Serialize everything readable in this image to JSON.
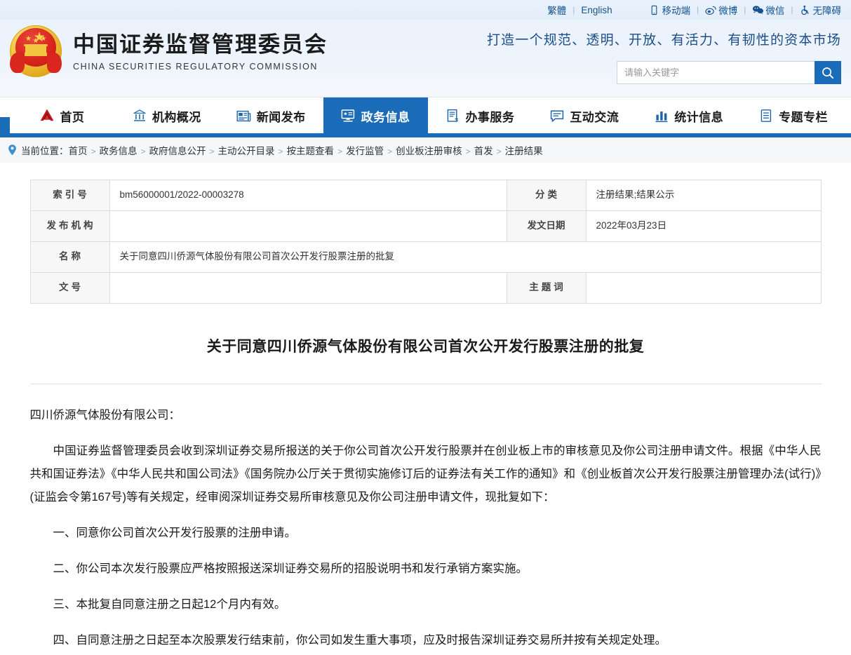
{
  "topbar": {
    "lang_traditional": "繁體",
    "lang_english": "English",
    "mobile": "移动端",
    "weibo": "微博",
    "wechat": "微信",
    "accessibility": "无障碍",
    "separator": "|",
    "accent": "#14538f"
  },
  "masthead": {
    "brand_cn": "中国证券监督管理委员会",
    "brand_en": "CHINA SECURITIES REGULATORY COMMISSION",
    "slogan": "打造一个规范、透明、开放、有活力、有韧性的资本市场",
    "search_placeholder": "请输入关键字",
    "search_value": "",
    "accent": "#1a6cb8"
  },
  "nav": {
    "active_index": 3,
    "items": [
      {
        "label": "首页",
        "icon": "csrc-home-logo-icon"
      },
      {
        "label": "机构概况",
        "icon": "bank-building-icon"
      },
      {
        "label": "新闻发布",
        "icon": "newspaper-icon"
      },
      {
        "label": "政务信息",
        "icon": "monitor-info-icon"
      },
      {
        "label": "办事服务",
        "icon": "document-service-icon"
      },
      {
        "label": "互动交流",
        "icon": "speech-bubble-icon"
      },
      {
        "label": "统计信息",
        "icon": "bar-chart-icon"
      },
      {
        "label": "专题专栏",
        "icon": "list-document-icon"
      }
    ]
  },
  "breadcrumb": {
    "prefix": "当前位置：",
    "separator": ">",
    "items": [
      "首页",
      "政务信息",
      "政府信息公开",
      "主动公开目录",
      "按主题查看",
      "发行监管",
      "创业板注册审核",
      "首发",
      "注册结果"
    ]
  },
  "meta_table": {
    "rows": [
      {
        "left_label": "索 引 号",
        "left_value": "bm56000001/2022-00003278",
        "right_label": "分    类",
        "right_value": "注册结果;结果公示"
      },
      {
        "left_label": "发布机构",
        "left_value": "",
        "right_label": "发文日期",
        "right_value": "2022年03月23日"
      },
      {
        "left_label": "名    称",
        "left_value": "关于同意四川侨源气体股份有限公司首次公开发行股票注册的批复",
        "full_width": true
      },
      {
        "left_label": "文    号",
        "left_value": "",
        "right_label": "主 题 词",
        "right_value": ""
      }
    ]
  },
  "document": {
    "title": "关于同意四川侨源气体股份有限公司首次公开发行股票注册的批复",
    "salutation": "四川侨源气体股份有限公司：",
    "paragraphs": [
      "中国证券监督管理委员会收到深圳证券交易所报送的关于你公司首次公开发行股票并在创业板上市的审核意见及你公司注册申请文件。根据《中华人民共和国证券法》《中华人民共和国公司法》《国务院办公厅关于贯彻实施修订后的证券法有关工作的通知》和《创业板首次公开发行股票注册管理办法(试行)》(证监会令第167号)等有关规定，经审阅深圳证券交易所审核意见及你公司注册申请文件，现批复如下：",
      "一、同意你公司首次公开发行股票的注册申请。",
      "二、你公司本次发行股票应严格按照报送深圳证券交易所的招股说明书和发行承销方案实施。",
      "三、本批复自同意注册之日起12个月内有效。",
      "四、自同意注册之日起至本次股票发行结束前，你公司如发生重大事项，应及时报告深圳证券交易所并按有关规定处理。"
    ]
  }
}
